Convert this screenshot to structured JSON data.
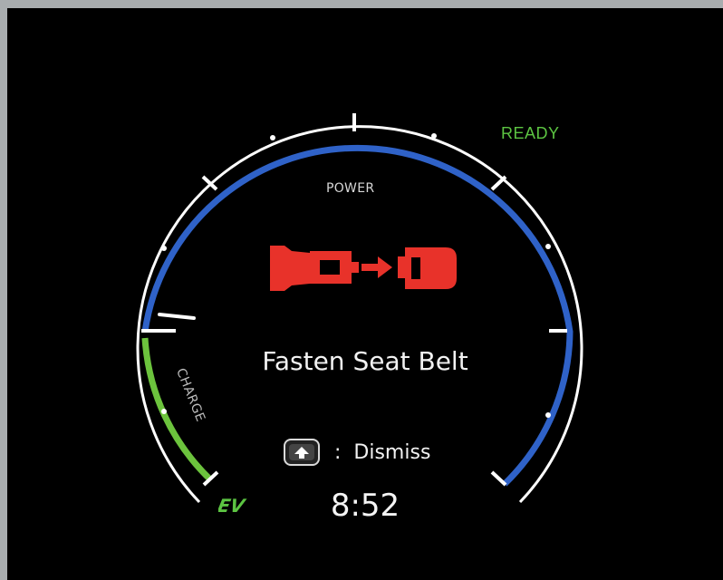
{
  "status": {
    "ready_label": "READY",
    "ready_color": "#5cc442"
  },
  "gauge": {
    "power_label": "POWER",
    "charge_label": "CHARGE",
    "power_color": "#2f62c8",
    "charge_color": "#6cc33d",
    "needle_level": "0"
  },
  "alert": {
    "icon": "seatbelt-warning-icon",
    "icon_color": "#e8322a",
    "message": "Fasten Seat Belt"
  },
  "dismiss": {
    "button_icon": "steering-button-up-icon",
    "separator": ":",
    "label": "Dismiss"
  },
  "mode": {
    "label": "EV",
    "color": "#5cc442"
  },
  "clock": {
    "time": "8:52"
  }
}
